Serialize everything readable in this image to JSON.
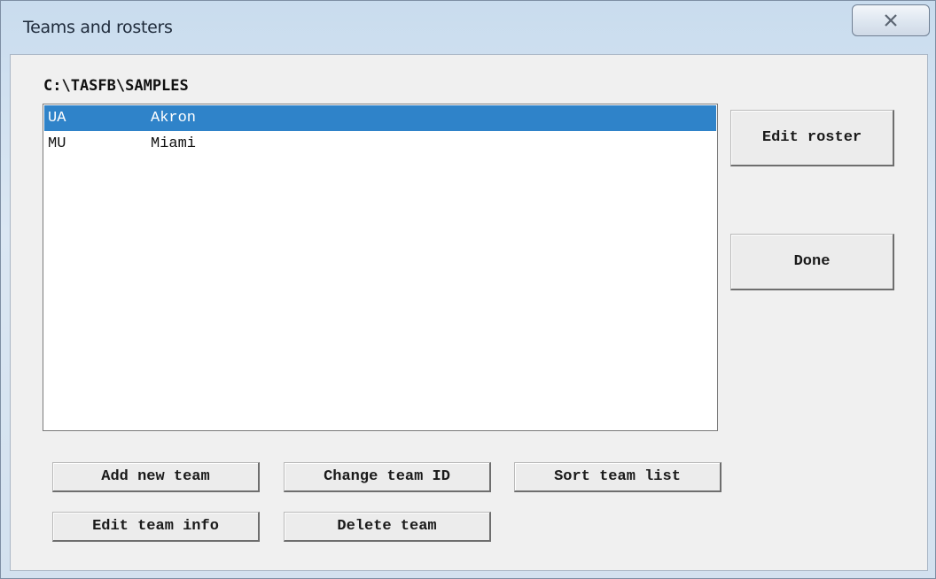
{
  "window": {
    "title": "Teams and rosters",
    "close_icon": "close-icon"
  },
  "path": "C:\\TASFB\\SAMPLES",
  "team_list": {
    "selected_index": 0,
    "rows": [
      {
        "id": "UA",
        "name": "Akron"
      },
      {
        "id": "MU",
        "name": "Miami"
      }
    ]
  },
  "buttons": {
    "edit_roster": "Edit roster",
    "done": "Done",
    "add_new_team": "Add new team",
    "change_team_id": "Change team ID",
    "sort_team_list": "Sort team list",
    "edit_team_info": "Edit team info",
    "delete_team": "Delete team"
  },
  "colors": {
    "selection": "#2f83c9",
    "dialog_bg": "#f0f0f0",
    "frame": "#c9dcee"
  }
}
